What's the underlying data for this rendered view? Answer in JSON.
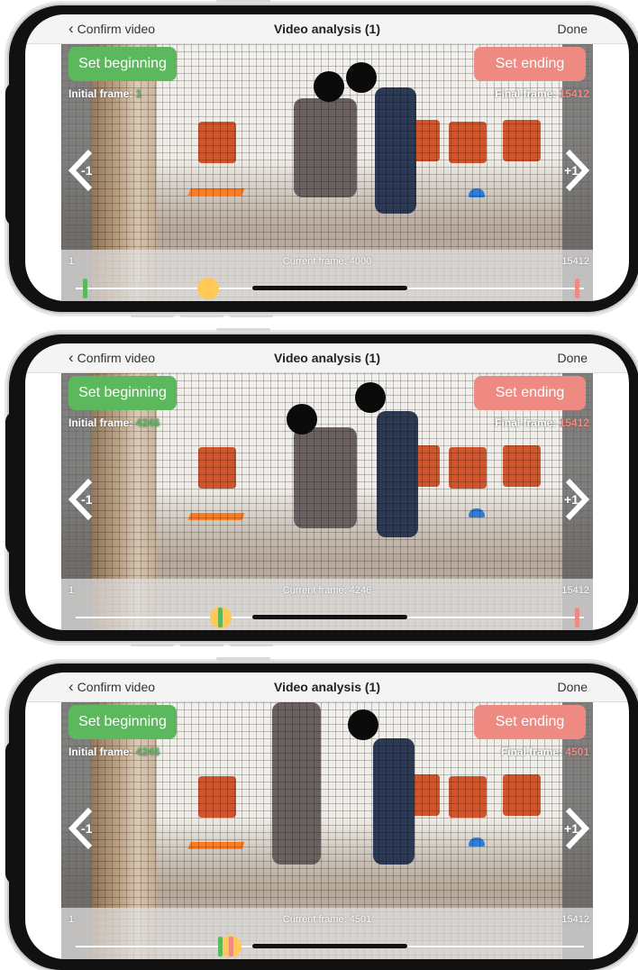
{
  "nav": {
    "back_label": "Confirm video",
    "title": "Video analysis (1)",
    "done_label": "Done"
  },
  "buttons": {
    "set_beginning": "Set beginning",
    "set_ending": "Set ending"
  },
  "labels": {
    "initial_frame": "Initial frame:",
    "final_frame": "Final frame:",
    "step_back": "-1",
    "step_forward": "+1"
  },
  "icons": {
    "back": "chevron-left-icon",
    "prev_frame": "chevron-left-icon",
    "next_frame": "chevron-right-icon"
  },
  "colors": {
    "green": "#5cb85c",
    "red": "#ef8a82",
    "knob": "#ffc857"
  },
  "screens": [
    {
      "initial_frame_value": "1",
      "final_frame_value": "15412",
      "range_min": "1",
      "range_max": "15412",
      "current_frame": "Current frame: 4000",
      "slider_fraction": 0.26,
      "start_marker_fraction": 0.02,
      "end_marker_fraction": 0.985
    },
    {
      "initial_frame_value": "4246",
      "final_frame_value": "15412",
      "range_min": "1",
      "range_max": "15412",
      "current_frame": "Current frame: 4246",
      "slider_fraction": 0.285,
      "start_marker_fraction": 0.285,
      "end_marker_fraction": 0.985
    },
    {
      "initial_frame_value": "4246",
      "final_frame_value": "4501",
      "range_min": "1",
      "range_max": "15412",
      "current_frame": "Current frame: 4501",
      "slider_fraction": 0.305,
      "start_marker_fraction": 0.285,
      "end_marker_fraction": 0.305
    }
  ]
}
